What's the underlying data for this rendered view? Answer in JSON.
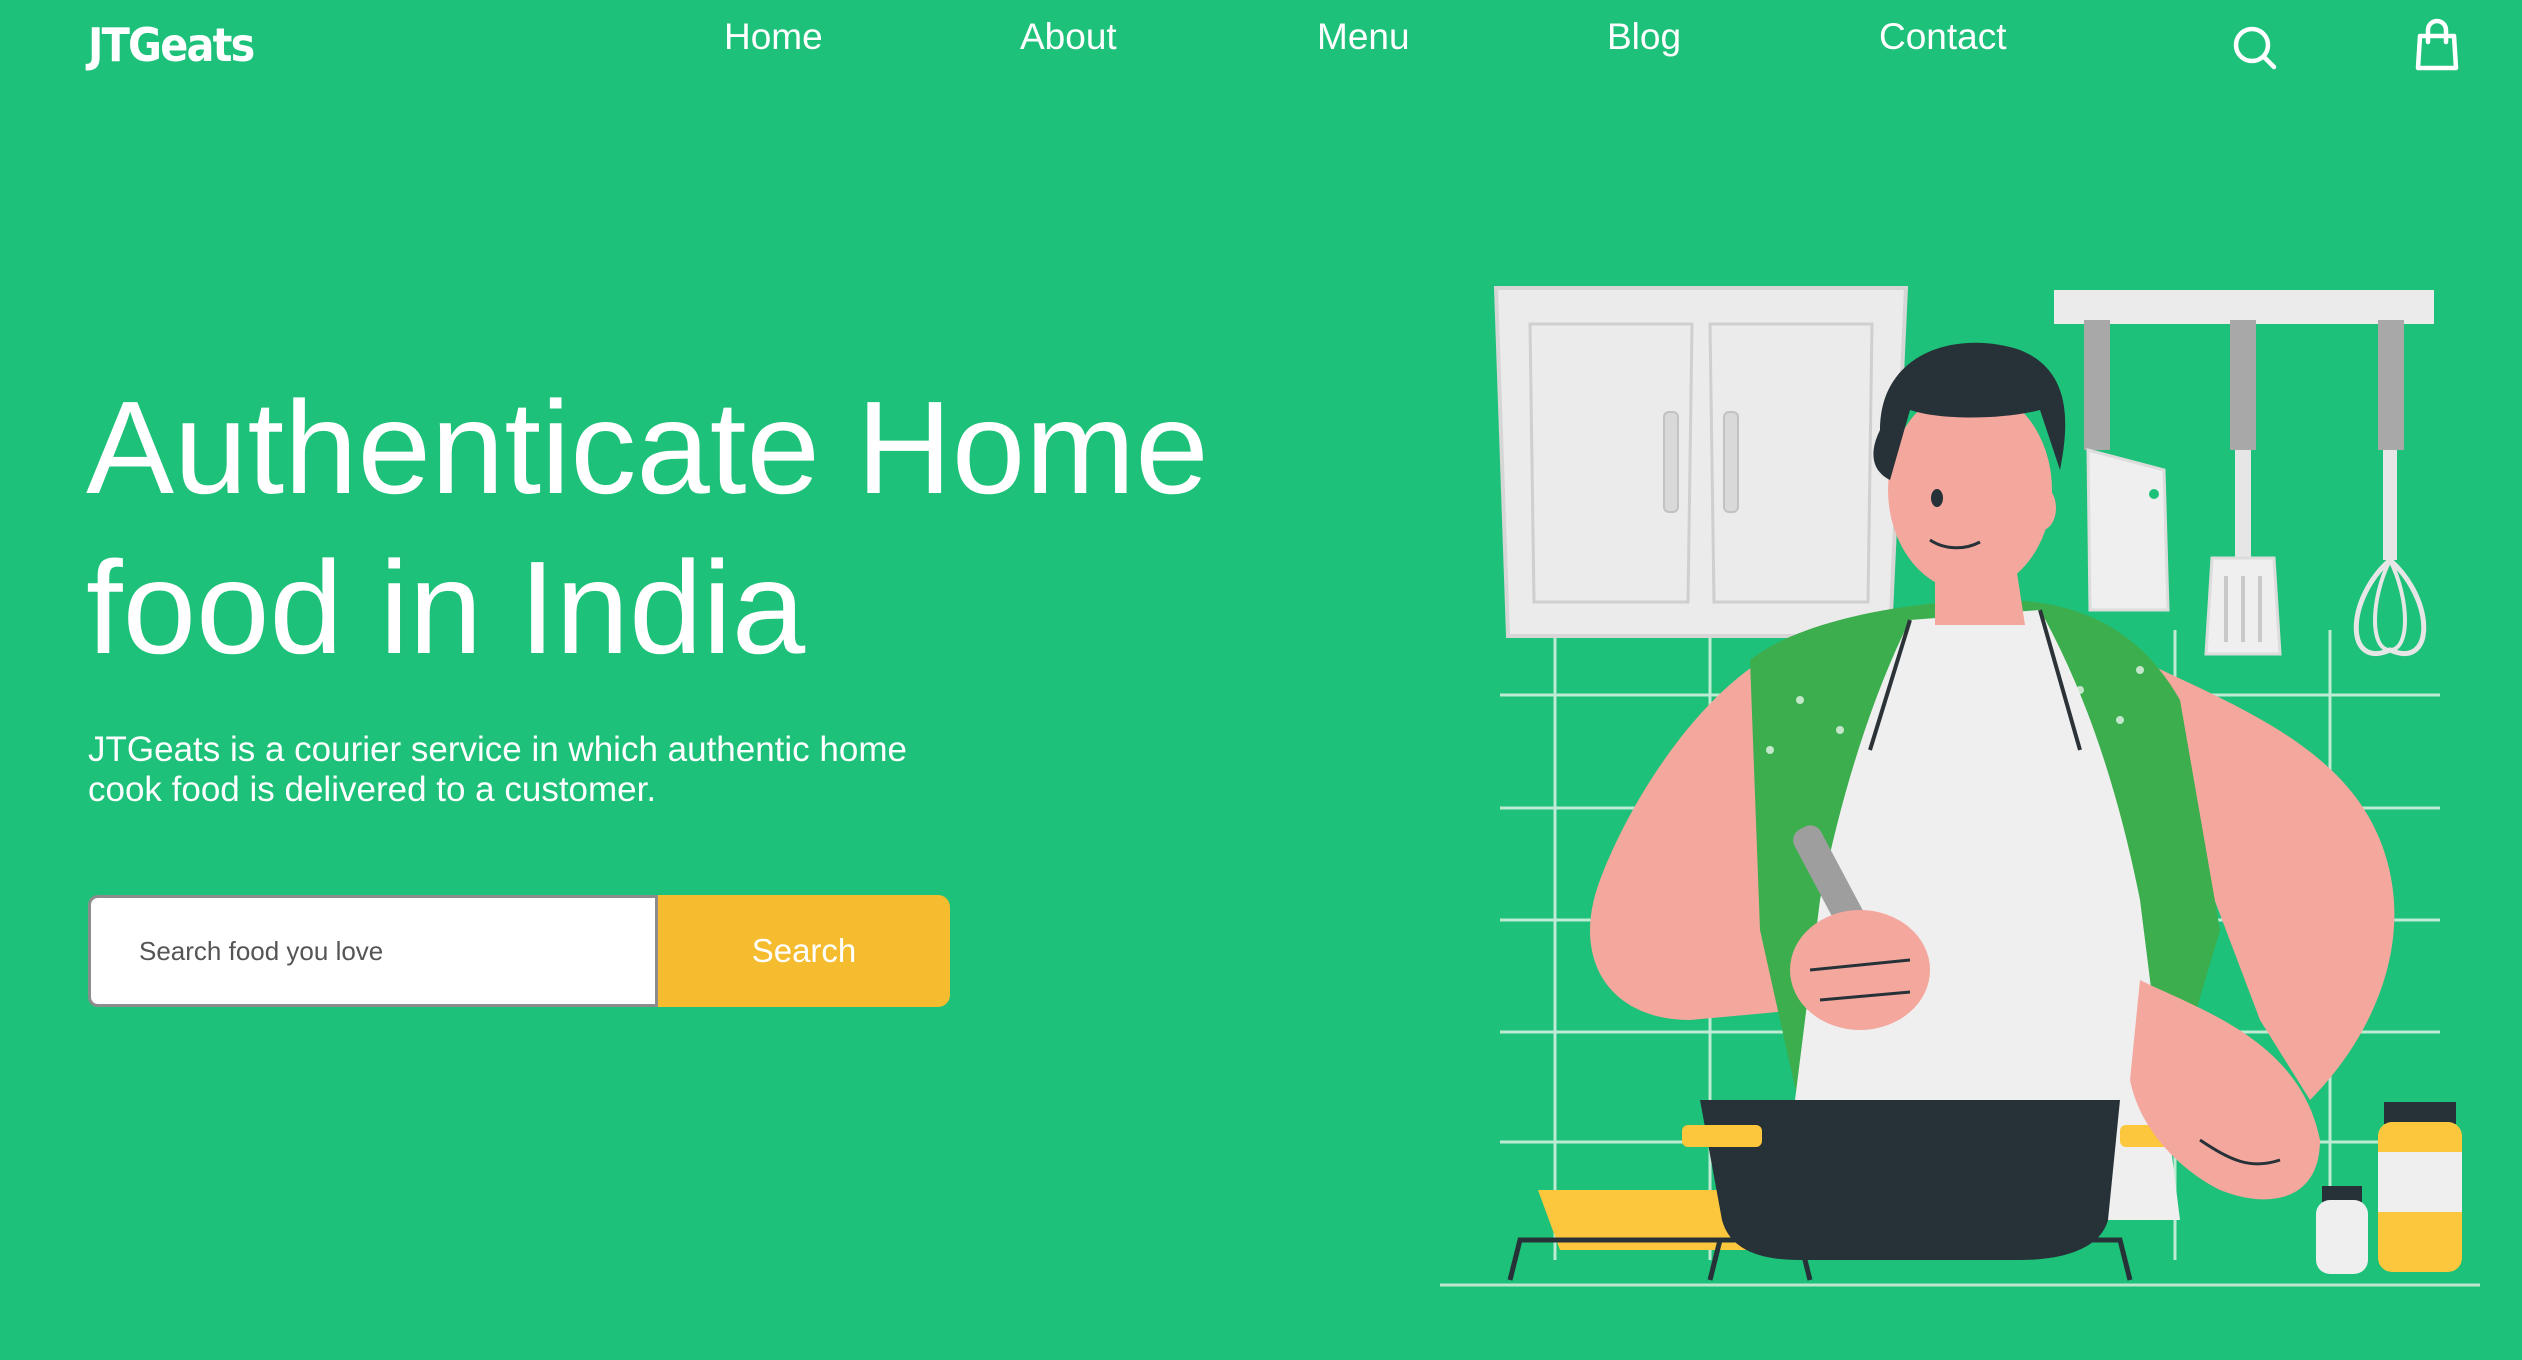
{
  "header": {
    "logo": "JTGeats",
    "nav": [
      {
        "label": "Home"
      },
      {
        "label": "About"
      },
      {
        "label": "Menu"
      },
      {
        "label": "Blog"
      },
      {
        "label": "Contact"
      }
    ],
    "icons": [
      "search-icon",
      "shopping-bag-icon"
    ]
  },
  "hero": {
    "title": "Authenticate Home food in India",
    "description": "JTGeats is a courier service in which authentic home cook food is delivered to a customer.",
    "search": {
      "placeholder": "Search food you love",
      "value": "",
      "button_label": "Search"
    },
    "illustration": "chef-cooking-illustration"
  },
  "colors": {
    "background": "#1ec179",
    "accent": "#f4bc2e",
    "text": "#ffffff",
    "input_border": "#8c8c8c"
  }
}
